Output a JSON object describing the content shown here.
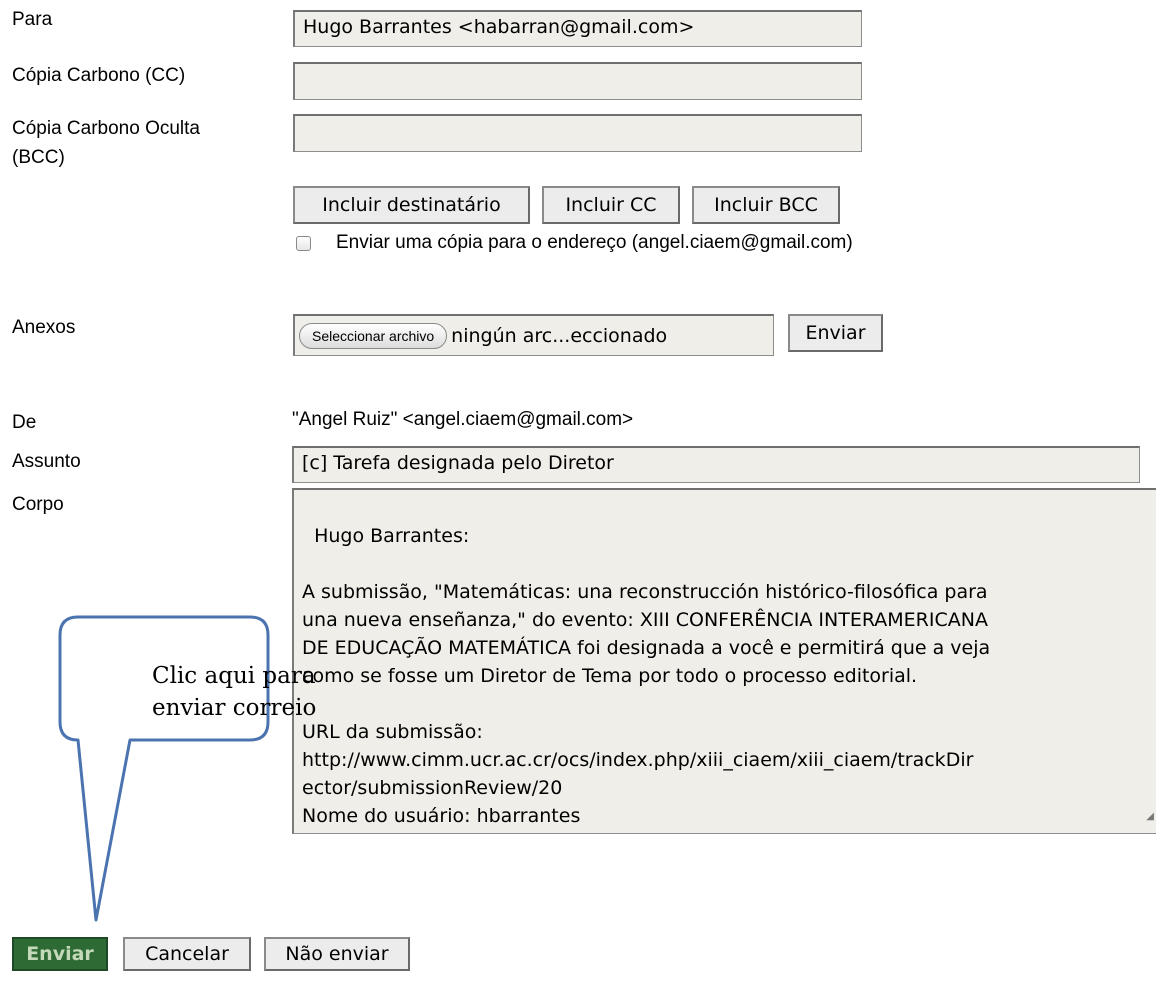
{
  "labels": {
    "to": "Para",
    "cc": "Cópia Carbono (CC)",
    "bcc_line1": "Cópia Carbono Oculta",
    "bcc_line2": "(BCC)",
    "attachments": "Anexos",
    "from": "De",
    "subject": "Assunto",
    "body": "Corpo"
  },
  "fields": {
    "to_value": "Hugo Barrantes <habarran@gmail.com>",
    "cc_value": "",
    "bcc_value": "",
    "subject_value": "[c] Tarefa designada pelo Diretor",
    "from_value": "\"Angel Ruiz\" <angel.ciaem@gmail.com>",
    "body_value": "Hugo Barrantes:\n\nA submissão, \"Matemáticas: una reconstrucción histórico-filosófica para\nuna nueva enseñanza,\" do evento: XIII CONFERÊNCIA INTERAMERICANA\nDE EDUCAÇÃO MATEMÁTICA foi designada a você e permitirá que a veja\ncomo se fosse um Diretor de Tema por todo o processo editorial.\n\nURL da submissão:\nhttp://www.cimm.ucr.ac.cr/ocs/index.php/xiii_ciaem/xiii_ciaem/trackDir\nector/submissionReview/20\nNome do usuário: hbarrantes\n\nObrigado,\nAngel Ruiz\nangel.ciaem@gmail.com"
  },
  "buttons": {
    "add_recipient": "Incluir destinatário",
    "add_cc": "Incluir CC",
    "add_bcc": "Incluir BCC",
    "upload": "Enviar",
    "send": "Enviar",
    "cancel": "Cancelar",
    "skip": "Não enviar"
  },
  "copy_checkbox": {
    "label": "Enviar uma cópia para o endereço (angel.ciaem@gmail.com)",
    "checked": false
  },
  "file_input": {
    "button": "Seleccionar archivo",
    "status": "ningún arc...eccionado"
  },
  "callout": {
    "text": "Clic aqui para enviar correio"
  },
  "colors": {
    "field_bg": "#efeee8",
    "send_bg": "#2e6b34",
    "callout_stroke": "#4a73b0"
  },
  "icons": {
    "resize_handle": "resize-grip-icon"
  }
}
